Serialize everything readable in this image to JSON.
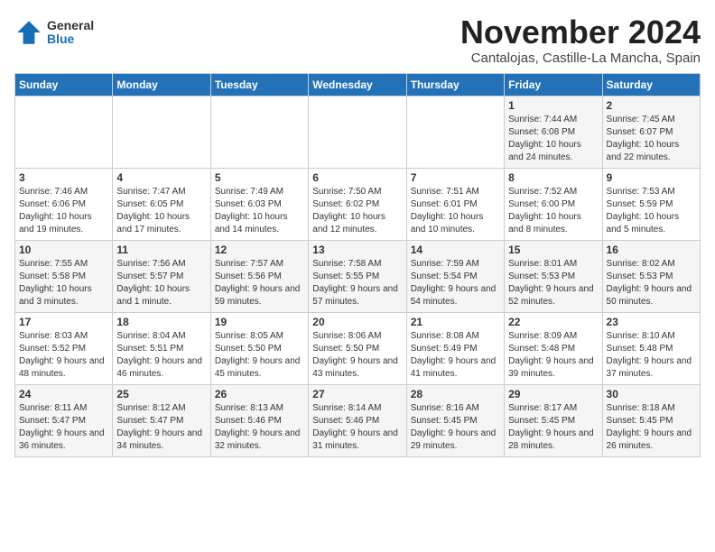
{
  "header": {
    "logo_general": "General",
    "logo_blue": "Blue",
    "month": "November 2024",
    "location": "Cantalojas, Castille-La Mancha, Spain"
  },
  "weekdays": [
    "Sunday",
    "Monday",
    "Tuesday",
    "Wednesday",
    "Thursday",
    "Friday",
    "Saturday"
  ],
  "weeks": [
    [
      {
        "day": "",
        "info": ""
      },
      {
        "day": "",
        "info": ""
      },
      {
        "day": "",
        "info": ""
      },
      {
        "day": "",
        "info": ""
      },
      {
        "day": "",
        "info": ""
      },
      {
        "day": "1",
        "info": "Sunrise: 7:44 AM\nSunset: 6:08 PM\nDaylight: 10 hours and 24 minutes."
      },
      {
        "day": "2",
        "info": "Sunrise: 7:45 AM\nSunset: 6:07 PM\nDaylight: 10 hours and 22 minutes."
      }
    ],
    [
      {
        "day": "3",
        "info": "Sunrise: 7:46 AM\nSunset: 6:06 PM\nDaylight: 10 hours and 19 minutes."
      },
      {
        "day": "4",
        "info": "Sunrise: 7:47 AM\nSunset: 6:05 PM\nDaylight: 10 hours and 17 minutes."
      },
      {
        "day": "5",
        "info": "Sunrise: 7:49 AM\nSunset: 6:03 PM\nDaylight: 10 hours and 14 minutes."
      },
      {
        "day": "6",
        "info": "Sunrise: 7:50 AM\nSunset: 6:02 PM\nDaylight: 10 hours and 12 minutes."
      },
      {
        "day": "7",
        "info": "Sunrise: 7:51 AM\nSunset: 6:01 PM\nDaylight: 10 hours and 10 minutes."
      },
      {
        "day": "8",
        "info": "Sunrise: 7:52 AM\nSunset: 6:00 PM\nDaylight: 10 hours and 8 minutes."
      },
      {
        "day": "9",
        "info": "Sunrise: 7:53 AM\nSunset: 5:59 PM\nDaylight: 10 hours and 5 minutes."
      }
    ],
    [
      {
        "day": "10",
        "info": "Sunrise: 7:55 AM\nSunset: 5:58 PM\nDaylight: 10 hours and 3 minutes."
      },
      {
        "day": "11",
        "info": "Sunrise: 7:56 AM\nSunset: 5:57 PM\nDaylight: 10 hours and 1 minute."
      },
      {
        "day": "12",
        "info": "Sunrise: 7:57 AM\nSunset: 5:56 PM\nDaylight: 9 hours and 59 minutes."
      },
      {
        "day": "13",
        "info": "Sunrise: 7:58 AM\nSunset: 5:55 PM\nDaylight: 9 hours and 57 minutes."
      },
      {
        "day": "14",
        "info": "Sunrise: 7:59 AM\nSunset: 5:54 PM\nDaylight: 9 hours and 54 minutes."
      },
      {
        "day": "15",
        "info": "Sunrise: 8:01 AM\nSunset: 5:53 PM\nDaylight: 9 hours and 52 minutes."
      },
      {
        "day": "16",
        "info": "Sunrise: 8:02 AM\nSunset: 5:53 PM\nDaylight: 9 hours and 50 minutes."
      }
    ],
    [
      {
        "day": "17",
        "info": "Sunrise: 8:03 AM\nSunset: 5:52 PM\nDaylight: 9 hours and 48 minutes."
      },
      {
        "day": "18",
        "info": "Sunrise: 8:04 AM\nSunset: 5:51 PM\nDaylight: 9 hours and 46 minutes."
      },
      {
        "day": "19",
        "info": "Sunrise: 8:05 AM\nSunset: 5:50 PM\nDaylight: 9 hours and 45 minutes."
      },
      {
        "day": "20",
        "info": "Sunrise: 8:06 AM\nSunset: 5:50 PM\nDaylight: 9 hours and 43 minutes."
      },
      {
        "day": "21",
        "info": "Sunrise: 8:08 AM\nSunset: 5:49 PM\nDaylight: 9 hours and 41 minutes."
      },
      {
        "day": "22",
        "info": "Sunrise: 8:09 AM\nSunset: 5:48 PM\nDaylight: 9 hours and 39 minutes."
      },
      {
        "day": "23",
        "info": "Sunrise: 8:10 AM\nSunset: 5:48 PM\nDaylight: 9 hours and 37 minutes."
      }
    ],
    [
      {
        "day": "24",
        "info": "Sunrise: 8:11 AM\nSunset: 5:47 PM\nDaylight: 9 hours and 36 minutes."
      },
      {
        "day": "25",
        "info": "Sunrise: 8:12 AM\nSunset: 5:47 PM\nDaylight: 9 hours and 34 minutes."
      },
      {
        "day": "26",
        "info": "Sunrise: 8:13 AM\nSunset: 5:46 PM\nDaylight: 9 hours and 32 minutes."
      },
      {
        "day": "27",
        "info": "Sunrise: 8:14 AM\nSunset: 5:46 PM\nDaylight: 9 hours and 31 minutes."
      },
      {
        "day": "28",
        "info": "Sunrise: 8:16 AM\nSunset: 5:45 PM\nDaylight: 9 hours and 29 minutes."
      },
      {
        "day": "29",
        "info": "Sunrise: 8:17 AM\nSunset: 5:45 PM\nDaylight: 9 hours and 28 minutes."
      },
      {
        "day": "30",
        "info": "Sunrise: 8:18 AM\nSunset: 5:45 PM\nDaylight: 9 hours and 26 minutes."
      }
    ]
  ]
}
